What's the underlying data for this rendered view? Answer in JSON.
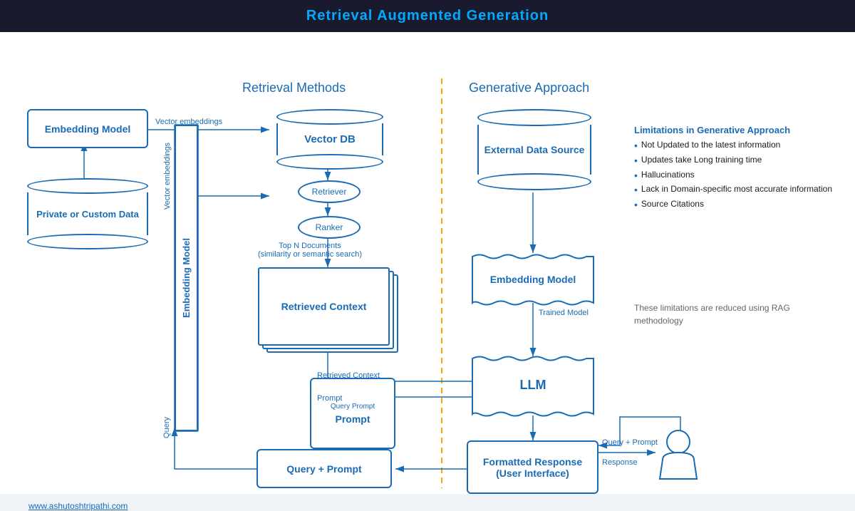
{
  "header": {
    "title": "Retrieval Augmented Generation"
  },
  "sections": {
    "retrieval": "Retrieval Methods",
    "generative": "Generative Approach"
  },
  "boxes": {
    "embedding_model_1": "Embedding Model",
    "private_data": "Private or Custom Data",
    "vector_db": "Vector DB",
    "retriever": "Retriever",
    "ranker": "Ranker",
    "retrieved_context": "Retrieved Context",
    "embedding_model_2": "Embedding Model",
    "external_data": "External Data Source",
    "llm": "LLM",
    "formatted_response": "Formatted Response\n(User Interface)",
    "query_prompt": "Query + Prompt"
  },
  "labels": {
    "vector_embeddings": "Vector embeddings",
    "vector_embeddings2": "Vector\nembeddings",
    "top_n_docs": "Top N Documents\n(similarity or semantic search)",
    "retrieved_context_arrow": "Retrieved Context",
    "prompt_arrow": "Prompt",
    "trained_model": "Trained Model",
    "query": "Query",
    "query_prompt_label": "Query + Prompt",
    "response": "Response"
  },
  "limitations": {
    "title": "Limitations in Generative Approach",
    "items": [
      "Not Updated to the latest information",
      "Updates take Long training time",
      "Hallucinations",
      "Lack in Domain-specific most accurate information",
      "Source Citations"
    ]
  },
  "rag_note": "These limitations are reduced using RAG\nmethodology",
  "footer": "www.ashutoshtripathi.com"
}
